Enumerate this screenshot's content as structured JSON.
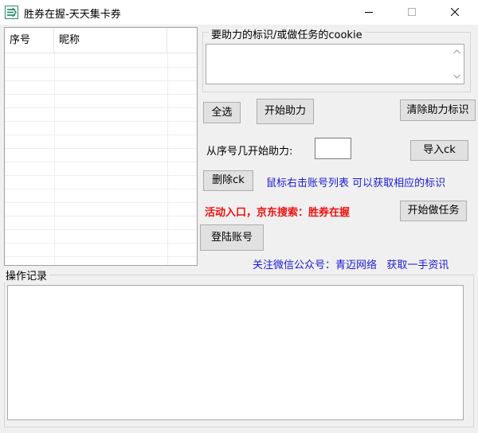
{
  "window": {
    "title": "胜券在握-天天集卡券"
  },
  "account_table": {
    "columns": [
      "序号",
      "昵称"
    ],
    "rows": []
  },
  "cookie_group": {
    "legend": "要助力的标识/或做任务的cookie",
    "value": ""
  },
  "buttons": {
    "select_all": "全选",
    "start_help": "开始助力",
    "clear_help": "清除助力标识",
    "import_ck": "导入ck",
    "delete_ck": "删除ck",
    "start_task": "开始做任务",
    "login": "登陆账号"
  },
  "start_index": {
    "label": "从序号几开始助力:",
    "value": ""
  },
  "hints": {
    "right_click_tip": "鼠标右击账号列表 可以获取相应的标识",
    "activity_entry": "活动入口，京东搜索：胜券在握",
    "follow_wechat": "关注微信公众号：青迈网络   获取一手资讯"
  },
  "log": {
    "legend": "操作记录",
    "content": ""
  },
  "colors": {
    "link_blue": "#1a1ad6",
    "alert_red": "#ee1111",
    "icon_green": "#2e8b6e"
  },
  "icons": {
    "app": "app-logo-icon",
    "minimize": "minimize-icon",
    "maximize": "maximize-icon",
    "close": "close-icon"
  }
}
